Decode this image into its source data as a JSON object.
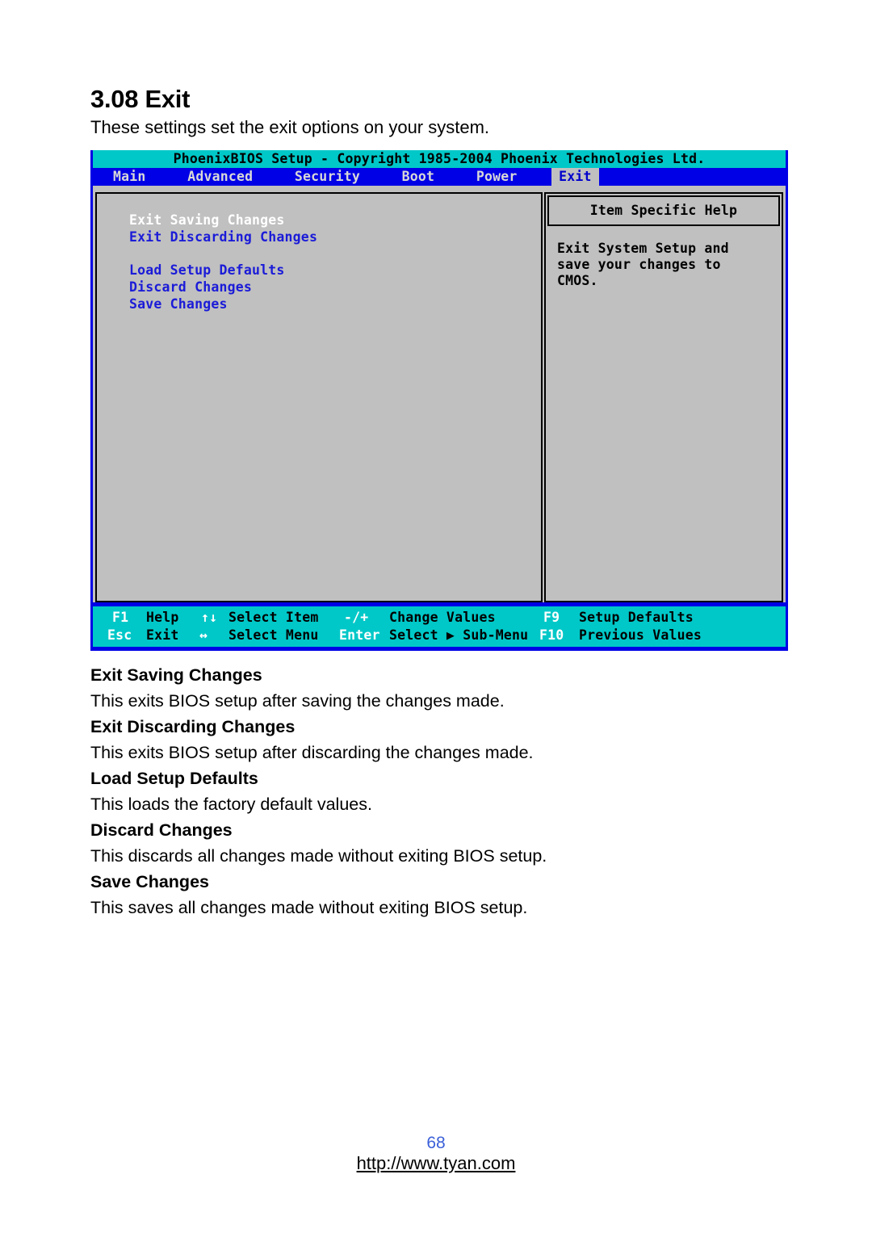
{
  "document": {
    "section_number_title": "3.08 Exit",
    "intro": "These settings set the exit options on your system."
  },
  "bios": {
    "title": "PhoenixBIOS Setup - Copyright 1985-2004 Phoenix Technologies Ltd.",
    "menu_tabs": [
      {
        "label": "Main",
        "active": false
      },
      {
        "label": "Advanced",
        "active": false
      },
      {
        "label": "Security",
        "active": false
      },
      {
        "label": "Boot",
        "active": false
      },
      {
        "label": "Power",
        "active": false
      },
      {
        "label": "Exit",
        "active": true
      }
    ],
    "options": [
      {
        "label": "Exit Saving Changes",
        "selected": true
      },
      {
        "label": "Exit Discarding Changes",
        "selected": false
      },
      {
        "label": "Load Setup Defaults",
        "selected": false
      },
      {
        "label": "Discard Changes",
        "selected": false
      },
      {
        "label": "Save Changes",
        "selected": false
      }
    ],
    "help": {
      "header": "Item Specific Help",
      "lines": [
        "Exit System Setup and",
        "save your changes to",
        "CMOS."
      ]
    },
    "keybar": {
      "row1": [
        {
          "key": "F1",
          "desc": "Help"
        },
        {
          "key": "↑↓",
          "desc": "Select Item"
        },
        {
          "key": "-/+",
          "desc": "Change Values"
        },
        {
          "key": "F9",
          "desc": "Setup Defaults"
        }
      ],
      "row2": [
        {
          "key": "Esc",
          "desc": "Exit"
        },
        {
          "key": "↔",
          "desc": "Select Menu"
        },
        {
          "key": "Enter",
          "desc": "Select ▶ Sub-Menu"
        },
        {
          "key": "F10",
          "desc": "Previous Values"
        }
      ]
    },
    "colors": {
      "title_bar": "#00c8c8",
      "menu_bar": "#0000e6",
      "panel": "#c0c0c0",
      "option_text": "#1b1bd8",
      "selected_option_text": "#ffffff",
      "key_label": "#ffffff"
    }
  },
  "descriptions": [
    {
      "heading": "Exit Saving Changes",
      "body": "This exits BIOS setup after saving the changes made."
    },
    {
      "heading": "Exit Discarding Changes",
      "body": "This exits BIOS setup after discarding the changes made."
    },
    {
      "heading": "Load Setup Defaults",
      "body": "This loads the factory default values."
    },
    {
      "heading": "Discard Changes",
      "body": "This discards all changes made without exiting BIOS setup."
    },
    {
      "heading": "Save Changes",
      "body": "This saves all changes made without exiting BIOS setup."
    }
  ],
  "footer": {
    "page_number": "68",
    "url": "http://www.tyan.com"
  }
}
